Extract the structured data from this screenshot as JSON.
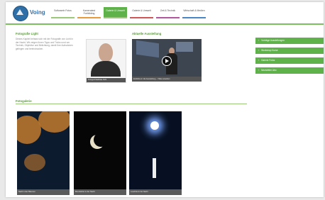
{
  "header": {
    "logo_text": "Voing",
    "nav": [
      {
        "label": "Softwareb Fotos"
      },
      {
        "label": "Kameratest Fortbilding"
      },
      {
        "label": "Galerie & Umwelt"
      },
      {
        "label": "Galerie & Umwelt"
      },
      {
        "label": "Zeit & Technik"
      },
      {
        "label": "Wirtschaft & Medien"
      }
    ],
    "active_nav_index": 2
  },
  "intro": {
    "title": "Fotografie Light",
    "text": "Dieses Kapitel befasst sich mit der Fotografie von Licht in der Nacht. Wir zeigen Ihnen Tipps und Tricks rund um Technik, Objektive und Belichtung, damit Ihre Aufnahmen gelingen und beeindrucken.",
    "portrait_caption": "Fotograf Matthias Pahl"
  },
  "video": {
    "title": "Aktuelle Ausstellung",
    "caption": "Einblicke in die Ausstellung – Video ansehen"
  },
  "side_links": [
    "Vorträge Ausstellungen",
    "Workshop Kurse",
    "Galerie Fotos",
    "Newsletter Abo"
  ],
  "gallery": {
    "title": "Fotogalerie",
    "items": [
      {
        "caption": "Nacht unter Bäumen"
      },
      {
        "caption": "Mondsichel in der Nacht"
      },
      {
        "caption": "Leuchtturm bei Nacht"
      }
    ]
  },
  "colors": {
    "accent_green": "#5fb14a",
    "brand_blue": "#3a6ea5"
  }
}
